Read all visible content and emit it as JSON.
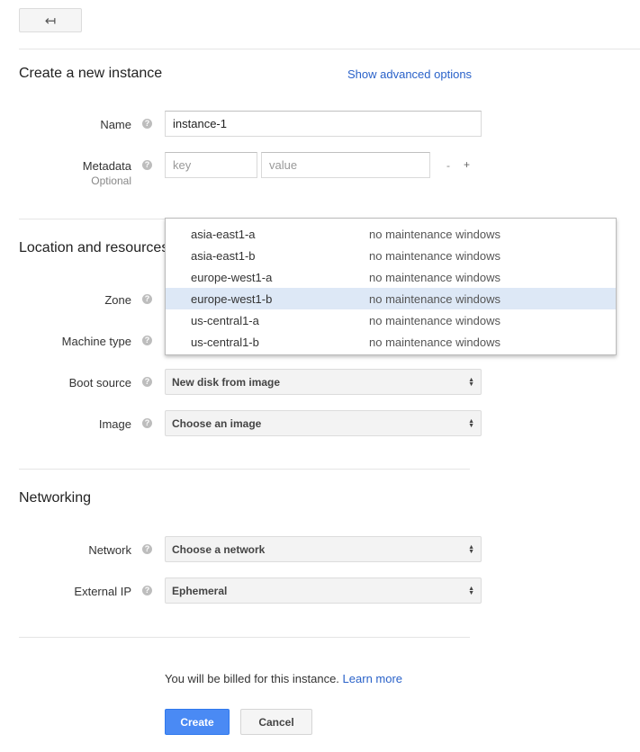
{
  "toolbar": {
    "back_icon": "back-arrow-icon",
    "back_glyph": "↤"
  },
  "header": {
    "title": "Create a new instance",
    "advanced_link": "Show advanced options"
  },
  "help_glyph": "?",
  "name_field": {
    "label": "Name",
    "value": "instance-1"
  },
  "metadata": {
    "label": "Metadata",
    "sublabel": "Optional",
    "key_placeholder": "key",
    "value_placeholder": "value",
    "remove_label": "-",
    "add_label": "+"
  },
  "location": {
    "title": "Location and resources",
    "zone_label": "Zone",
    "machine_type_label": "Machine type",
    "boot_source": {
      "label": "Boot source",
      "value": "New disk from image"
    },
    "image": {
      "label": "Image",
      "value": "Choose an image"
    }
  },
  "zone_dropdown": {
    "options": [
      {
        "zone": "asia-east1-a",
        "maintenance": "no maintenance windows"
      },
      {
        "zone": "asia-east1-b",
        "maintenance": "no maintenance windows"
      },
      {
        "zone": "europe-west1-a",
        "maintenance": "no maintenance windows"
      },
      {
        "zone": "europe-west1-b",
        "maintenance": "no maintenance windows"
      },
      {
        "zone": "us-central1-a",
        "maintenance": "no maintenance windows"
      },
      {
        "zone": "us-central1-b",
        "maintenance": "no maintenance windows"
      }
    ],
    "highlighted": "europe-west1-b"
  },
  "networking": {
    "title": "Networking",
    "network": {
      "label": "Network",
      "value": "Choose a network"
    },
    "external_ip": {
      "label": "External IP",
      "value": "Ephemeral"
    }
  },
  "billing": {
    "text": "You will be billed for this instance.",
    "learn_more": "Learn more"
  },
  "actions": {
    "create_label": "Create",
    "cancel_label": "Cancel"
  },
  "colors": {
    "primary_button": "#4a8af4",
    "link": "#2a62c9",
    "dropdown_highlight": "#dde8f6"
  }
}
